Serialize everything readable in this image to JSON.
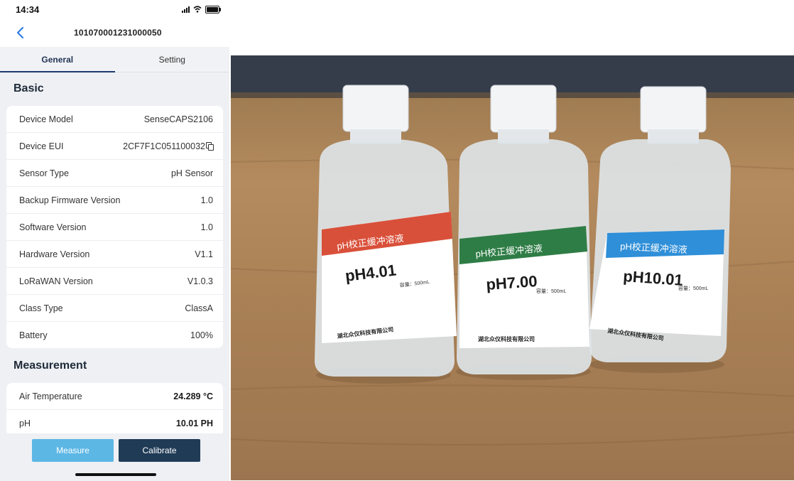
{
  "status_bar": {
    "time": "14:34"
  },
  "nav": {
    "title": "101070001231000050"
  },
  "tabs": [
    {
      "label": "General",
      "active": true
    },
    {
      "label": "Setting",
      "active": false
    }
  ],
  "basic": {
    "title": "Basic",
    "rows": [
      {
        "label": "Device Model",
        "value": "SenseCAPS2106"
      },
      {
        "label": "Device EUI",
        "value": "2CF7F1C051100032"
      },
      {
        "label": "Sensor Type",
        "value": "pH Sensor"
      },
      {
        "label": "Backup Firmware Version",
        "value": "1.0"
      },
      {
        "label": "Software Version",
        "value": "1.0"
      },
      {
        "label": "Hardware Version",
        "value": "V1.1"
      },
      {
        "label": "LoRaWAN Version",
        "value": "V1.0.3"
      },
      {
        "label": "Class Type",
        "value": "ClassA"
      },
      {
        "label": "Battery",
        "value": "100%"
      }
    ]
  },
  "measurement": {
    "title": "Measurement",
    "rows": [
      {
        "label": "Air Temperature",
        "value": "24.289 °C"
      },
      {
        "label": "pH",
        "value": "10.01 PH"
      }
    ]
  },
  "buttons": {
    "measure": "Measure",
    "calibrate": "Calibrate"
  },
  "colors": {
    "accent_blue": "#5cb7e5",
    "dark_navy": "#1f3b56",
    "tab_underline": "#1e3a6e",
    "back_arrow": "#2f7de1"
  },
  "photo": {
    "bottles": [
      {
        "header": "pH校正缓冲溶液",
        "value": "pH4.01",
        "label_color": "#d9503a",
        "footer": "湖北众仪科技有限公司"
      },
      {
        "header": "pH校正缓冲溶液",
        "value": "pH7.00",
        "label_color": "#2f7d46",
        "footer": "湖北众仪科技有限公司"
      },
      {
        "header": "pH校正缓冲溶液",
        "value": "pH10.01",
        "label_color": "#2f8fd8",
        "footer": "湖北众仪科技有限公司"
      }
    ],
    "volume": "容量：500mL"
  }
}
